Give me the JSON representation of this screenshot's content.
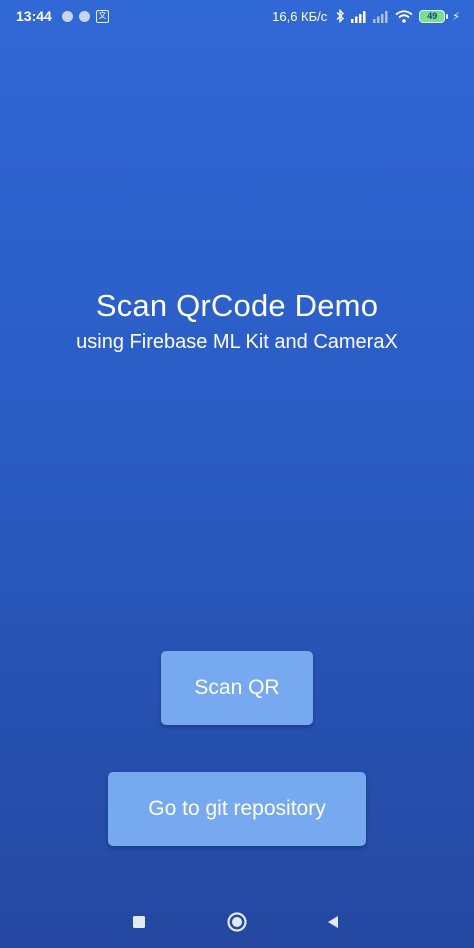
{
  "status_bar": {
    "time": "13:44",
    "left_icons": [
      "notification-dot-icon",
      "notification-dot-icon",
      "translate-icon"
    ],
    "speed": "16,6 КБ/с",
    "right_icons": [
      "bluetooth-icon",
      "signal-icon",
      "signal-icon",
      "wifi-icon",
      "battery-icon"
    ],
    "battery": "49"
  },
  "main": {
    "title": "Scan QrCode Demo",
    "subtitle": "using Firebase ML Kit and CameraX"
  },
  "buttons": {
    "scan_label": "Scan QR",
    "git_label": "Go to git repository"
  },
  "nav_bar": {
    "icons": [
      "recents-square-icon",
      "home-circle-icon",
      "back-triangle-icon"
    ]
  },
  "colors": {
    "background_top": "#3068d6",
    "background_bottom": "#2448a0",
    "button": "#76a9ef",
    "battery_fill": "#78e08f"
  }
}
